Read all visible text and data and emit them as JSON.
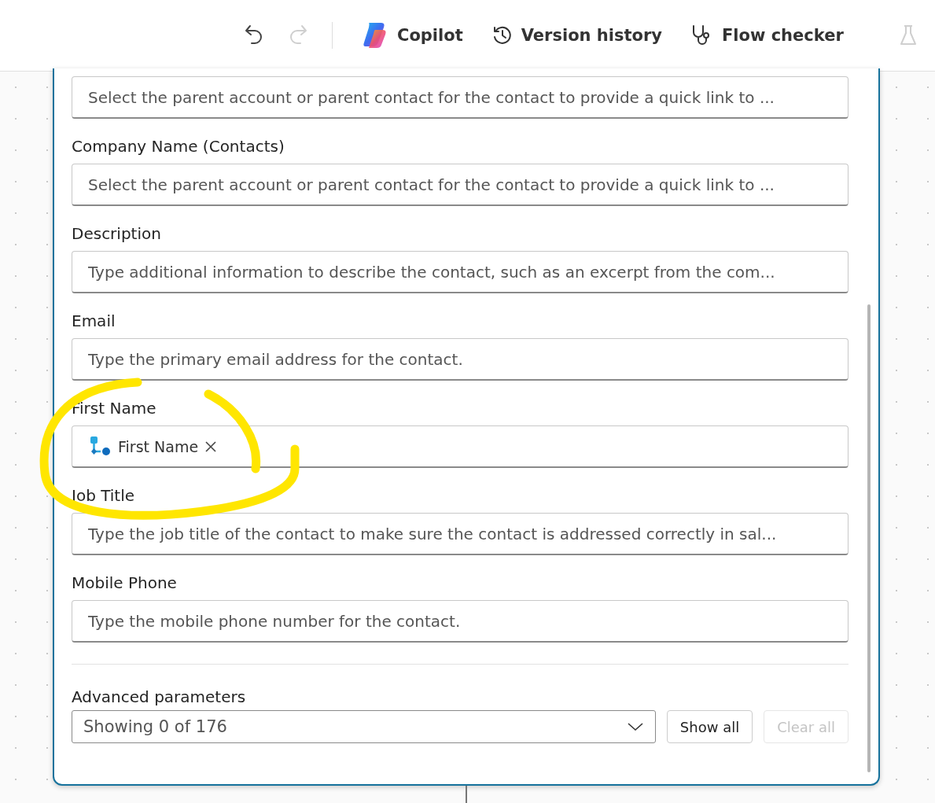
{
  "toolbar": {
    "undo": {
      "disabled": false
    },
    "redo": {
      "disabled": true
    },
    "buttons": [
      {
        "kind": "copilot",
        "label": "Copilot"
      },
      {
        "kind": "history",
        "label": "Version history"
      },
      {
        "kind": "checker",
        "label": "Flow checker"
      }
    ],
    "test": {
      "disabled": true
    }
  },
  "fields": [
    {
      "kind": "text",
      "placeholder": "Select the parent account or parent contact for the contact to provide a quick link to ..."
    },
    {
      "kind": "text",
      "label": "Company Name (Contacts)",
      "placeholder": "Select the parent account or parent contact for the contact to provide a quick link to ..."
    },
    {
      "kind": "text",
      "label": "Description",
      "placeholder": "Type additional information to describe the contact, such as an excerpt from the com..."
    },
    {
      "kind": "text",
      "label": "Email",
      "placeholder": "Type the primary email address for the contact."
    },
    {
      "kind": "token",
      "label": "First Name",
      "token": "First Name"
    },
    {
      "kind": "text",
      "label": "Job Title",
      "placeholder": "Type the job title of the contact to make sure the contact is addressed correctly in sal..."
    },
    {
      "kind": "text",
      "label": "Mobile Phone",
      "placeholder": "Type the mobile phone number for the contact."
    }
  ],
  "advanced": {
    "label": "Advanced parameters",
    "value": "Showing 0 of 176",
    "buttons": [
      {
        "label": "Show all",
        "disabled": false
      },
      {
        "label": "Clear all",
        "disabled": true
      }
    ]
  }
}
